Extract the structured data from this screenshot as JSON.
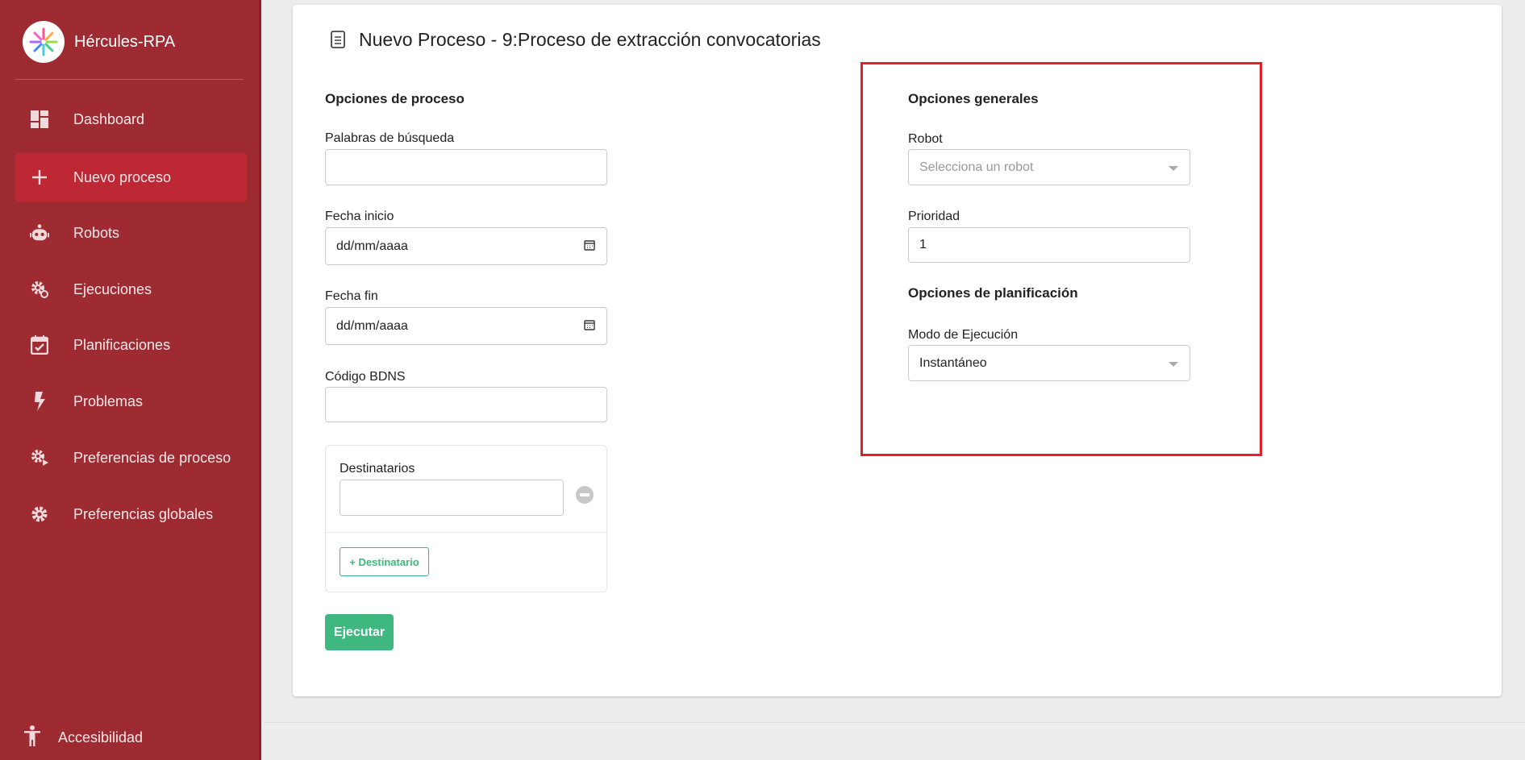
{
  "sidebar": {
    "brand": "Hércules-RPA",
    "items": [
      {
        "label": "Dashboard",
        "icon": "dashboard-icon"
      },
      {
        "label": "Nuevo proceso",
        "icon": "plus-icon",
        "active": true
      },
      {
        "label": "Robots",
        "icon": "robot-icon"
      },
      {
        "label": "Ejecuciones",
        "icon": "gears-icon"
      },
      {
        "label": "Planificaciones",
        "icon": "calendar-check-icon"
      },
      {
        "label": "Problemas",
        "icon": "bolt-icon"
      },
      {
        "label": "Preferencias de proceso",
        "icon": "gear-play-icon"
      },
      {
        "label": "Preferencias globales",
        "icon": "gear-icon"
      }
    ],
    "accessibility": "Accesibilidad"
  },
  "page": {
    "title": "Nuevo Proceso - 9:Proceso de extracción convocatorias",
    "process_options": {
      "heading": "Opciones de proceso",
      "keywords_label": "Palabras de búsqueda",
      "keywords_value": "",
      "start_label": "Fecha inicio",
      "start_placeholder": "dd/mm/aaaa",
      "end_label": "Fecha fin",
      "end_placeholder": "dd/mm/aaaa",
      "bdns_label": "Código BDNS",
      "bdns_value": "",
      "recipients_label": "Destinatarios",
      "add_recipient": "+ Destinatario",
      "execute": "Ejecutar"
    },
    "general_options": {
      "heading": "Opciones generales",
      "robot_label": "Robot",
      "robot_placeholder": "Selecciona un robot",
      "priority_label": "Prioridad",
      "priority_value": "1"
    },
    "planning_options": {
      "heading": "Opciones de planificación",
      "mode_label": "Modo de Ejecución",
      "mode_value": "Instantáneo"
    }
  },
  "colors": {
    "sidebar": "#9e2a32",
    "active": "#bd2834",
    "accent": "#3fb87f",
    "highlight": "#e3202a"
  }
}
